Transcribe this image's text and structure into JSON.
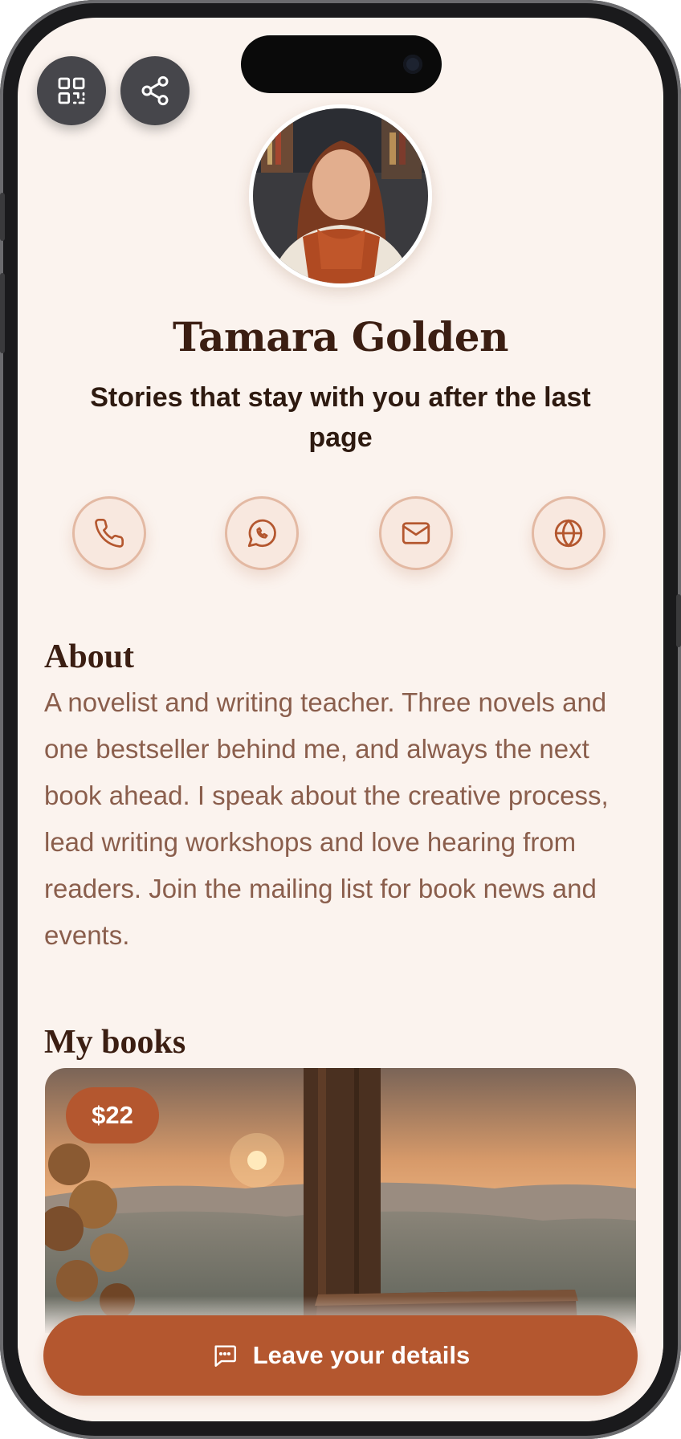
{
  "profile": {
    "name": "Tamara Golden",
    "tagline": "Stories that stay with you after the last page"
  },
  "top_actions": {
    "qr_icon": "qr-code-icon",
    "share_icon": "share-icon"
  },
  "contacts": [
    {
      "icon": "phone-icon"
    },
    {
      "icon": "whatsapp-icon"
    },
    {
      "icon": "mail-icon"
    },
    {
      "icon": "globe-icon"
    }
  ],
  "about": {
    "heading": "About",
    "text": "A novelist and writing teacher. Three novels and one bestseller behind me, and always the next book ahead. I speak about the creative process, lead writing workshops and love hearing from readers. Join the mailing list for book news and events."
  },
  "books": {
    "heading": "My books",
    "items": [
      {
        "price": "$22"
      }
    ]
  },
  "cta": {
    "label": "Leave your details",
    "icon": "chat-icon"
  },
  "colors": {
    "accent": "#b4572f",
    "background": "#fbf3ee",
    "heading": "#3b1e12",
    "body_text": "#8a5e4c",
    "button_dark": "#46464b"
  }
}
